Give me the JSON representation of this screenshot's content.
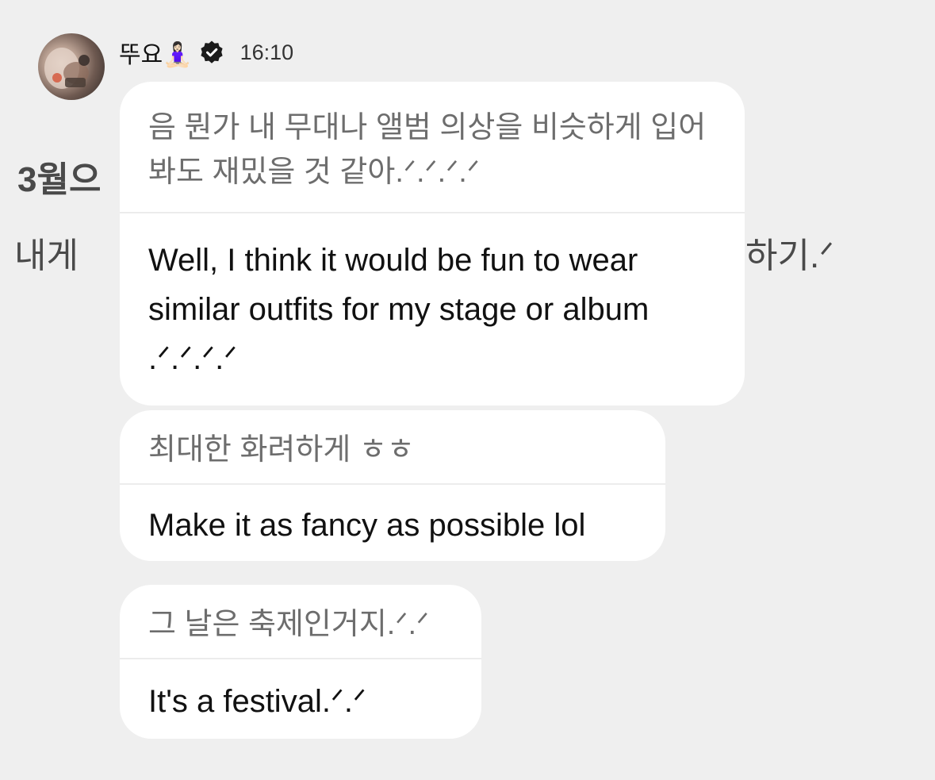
{
  "header": {
    "sender_name": "뚜요🧘🏻‍♀️",
    "timestamp": "16:10",
    "verified_icon": "verified-badge-icon"
  },
  "background_post": {
    "title_fragment": "3월으",
    "line_left": "내게",
    "line_right": "하기.ᐟ"
  },
  "messages": [
    {
      "original": "음 뭔가 내 무대나 앨범 의상을 비슷하게 입어봐도 재밌을 것 같아.ᐟ.ᐟ.ᐟ.ᐟ",
      "translation": "Well, I think it would be fun to wear similar outfits for my stage or album .ᐟ.ᐟ.ᐟ.ᐟ"
    },
    {
      "original": "최대한 화려하게 ㅎㅎ",
      "translation": "Make it as fancy as possible lol"
    },
    {
      "original": "그 날은 축제인거지.ᐟ.ᐟ",
      "translation": "It's a festival.ᐟ.ᐟ"
    }
  ],
  "colors": {
    "background": "#efefef",
    "bubble": "#ffffff",
    "original_text": "#6d6d6d",
    "translation_text": "#111111",
    "divider": "#ececec"
  }
}
